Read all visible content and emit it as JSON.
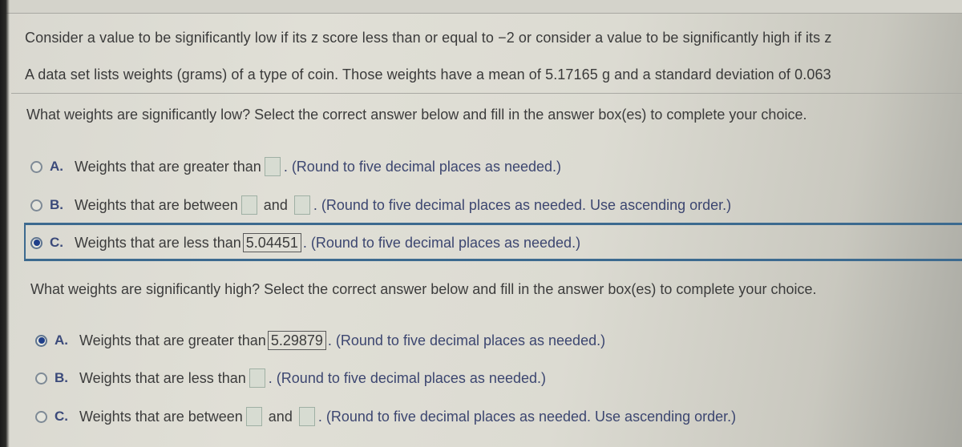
{
  "intro": {
    "line1": "Consider a value to be significantly low if its z score less than or equal to −2 or consider a value to be significantly high if its z",
    "line2": "A data set lists weights (grams) of a type of coin. Those weights have a mean of 5.17165 g and a standard deviation of 0.063"
  },
  "low_question": {
    "prompt": "What weights are significantly low? Select the correct answer below and fill in the answer box(es) to complete your choice.",
    "options": [
      {
        "letter": "A.",
        "text_before": "Weights that are greater than",
        "box1": "",
        "hint": ". (Round to five decimal places as needed.)",
        "selected": false
      },
      {
        "letter": "B.",
        "text_before": "Weights that are between",
        "box1": "",
        "and": "and",
        "box2": "",
        "hint": ". (Round to five decimal places as needed. Use ascending order.)",
        "selected": false
      },
      {
        "letter": "C.",
        "text_before": "Weights that are less than",
        "box1": "5.04451",
        "hint": ". (Round to five decimal places as needed.)",
        "selected": true
      }
    ]
  },
  "high_question": {
    "prompt": "What weights are significantly high? Select the correct answer below and fill in the answer box(es) to complete your choice.",
    "options": [
      {
        "letter": "A.",
        "text_before": "Weights that are greater than",
        "box1": "5.29879",
        "hint": ". (Round to five decimal places as needed.)",
        "selected": true
      },
      {
        "letter": "B.",
        "text_before": "Weights that are less than",
        "box1": "",
        "hint": ". (Round to five decimal places as needed.)",
        "selected": false
      },
      {
        "letter": "C.",
        "text_before": "Weights that are between",
        "box1": "",
        "and": "and",
        "box2": "",
        "hint": ". (Round to five decimal places as needed. Use ascending order.)",
        "selected": false
      }
    ]
  },
  "colors": {
    "selected_radio": "#1f3f8a",
    "selection_frame": "#3c6a8f",
    "option_letter": "#3b4a7a"
  }
}
